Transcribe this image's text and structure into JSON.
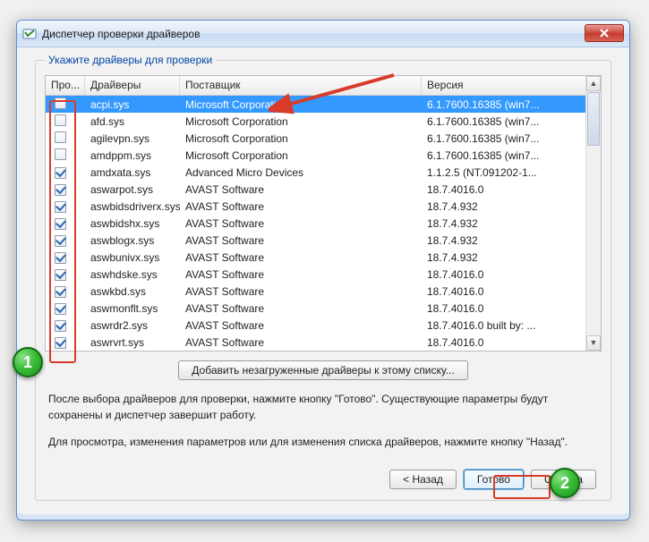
{
  "window": {
    "title": "Диспетчер проверки драйверов"
  },
  "group": {
    "label": "Укажите драйверы для проверки"
  },
  "columns": {
    "check": "Про...",
    "driver": "Драйверы",
    "vendor": "Поставщик",
    "version": "Версия"
  },
  "drivers": [
    {
      "checked": false,
      "name": "acpi.sys",
      "vendor": "Microsoft Corporation",
      "version": "6.1.7600.16385 (win7...",
      "selected": true
    },
    {
      "checked": false,
      "name": "afd.sys",
      "vendor": "Microsoft Corporation",
      "version": "6.1.7600.16385 (win7..."
    },
    {
      "checked": false,
      "name": "agilevpn.sys",
      "vendor": "Microsoft Corporation",
      "version": "6.1.7600.16385 (win7..."
    },
    {
      "checked": false,
      "name": "amdppm.sys",
      "vendor": "Microsoft Corporation",
      "version": "6.1.7600.16385 (win7..."
    },
    {
      "checked": true,
      "name": "amdxata.sys",
      "vendor": "Advanced Micro Devices",
      "version": "1.1.2.5 (NT.091202-1..."
    },
    {
      "checked": true,
      "name": "aswarpot.sys",
      "vendor": "AVAST Software",
      "version": "18.7.4016.0"
    },
    {
      "checked": true,
      "name": "aswbidsdriverx.sys",
      "vendor": "AVAST Software",
      "version": "18.7.4.932"
    },
    {
      "checked": true,
      "name": "aswbidshx.sys",
      "vendor": "AVAST Software",
      "version": "18.7.4.932"
    },
    {
      "checked": true,
      "name": "aswblogx.sys",
      "vendor": "AVAST Software",
      "version": "18.7.4.932"
    },
    {
      "checked": true,
      "name": "aswbunivx.sys",
      "vendor": "AVAST Software",
      "version": "18.7.4.932"
    },
    {
      "checked": true,
      "name": "aswhdske.sys",
      "vendor": "AVAST Software",
      "version": "18.7.4016.0"
    },
    {
      "checked": true,
      "name": "aswkbd.sys",
      "vendor": "AVAST Software",
      "version": "18.7.4016.0"
    },
    {
      "checked": true,
      "name": "aswmonflt.sys",
      "vendor": "AVAST Software",
      "version": "18.7.4016.0"
    },
    {
      "checked": true,
      "name": "aswrdr2.sys",
      "vendor": "AVAST Software",
      "version": "18.7.4016.0 built by: ..."
    },
    {
      "checked": true,
      "name": "aswrvrt.sys",
      "vendor": "AVAST Software",
      "version": "18.7.4016.0"
    }
  ],
  "buttons": {
    "add_unloaded": "Добавить незагруженные драйверы к этому списку...",
    "back": "< Назад",
    "finish": "Готово",
    "cancel": "Отмена"
  },
  "info": {
    "p1": "После выбора драйверов для проверки, нажмите кнопку \"Готово\". Существующие параметры будут сохранены и диспетчер завершит работу.",
    "p2": "Для просмотра, изменения параметров или для изменения списка драйверов, нажмите кнопку \"Назад\"."
  },
  "annotations": {
    "badge1": "1",
    "badge2": "2"
  }
}
